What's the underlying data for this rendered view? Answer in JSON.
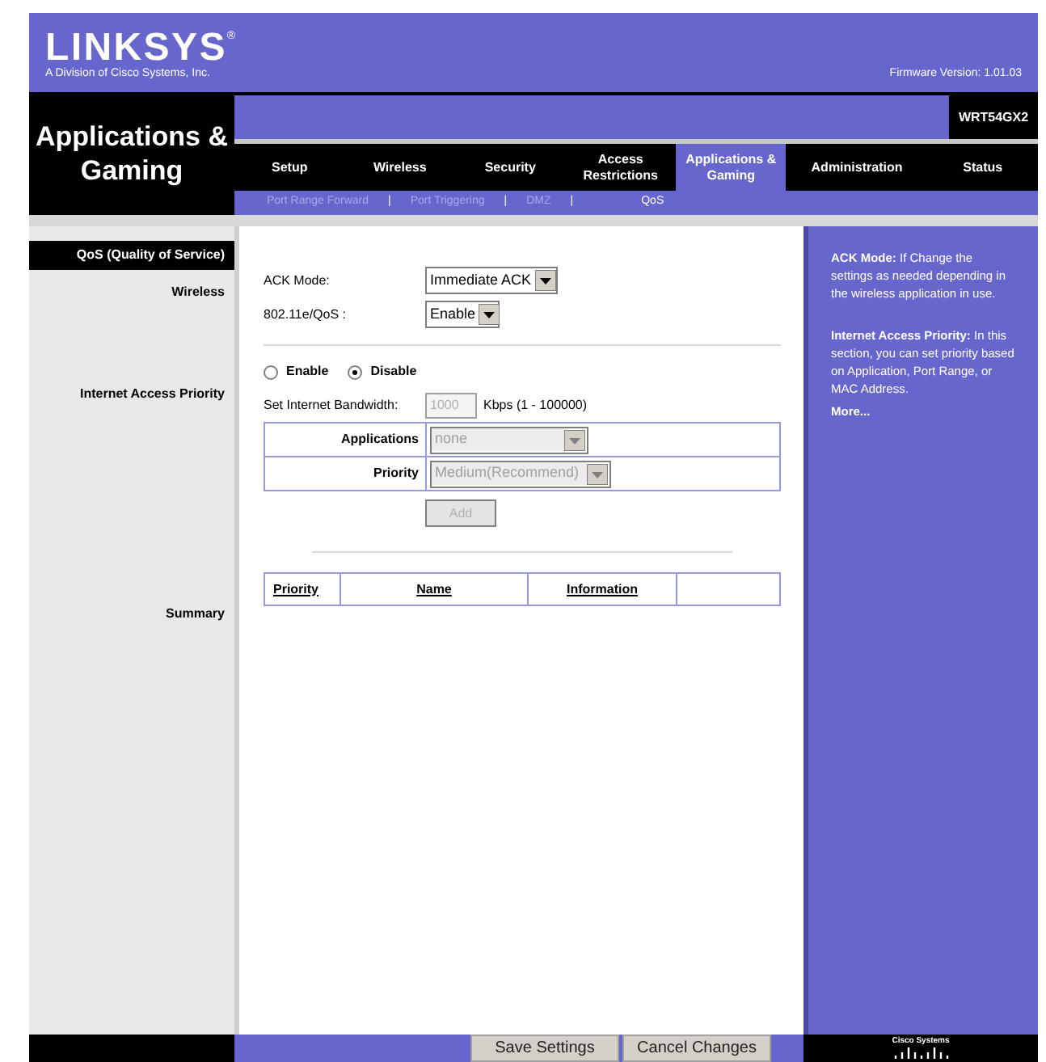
{
  "header": {
    "logo": "LINKSYS",
    "registered": "®",
    "tagline": "A Division of Cisco Systems, Inc.",
    "firmware": "Firmware Version: 1.01.03"
  },
  "section_title": "Applications & Gaming",
  "model": "WRT54GX2",
  "tabs": [
    {
      "label": "Setup",
      "selected": false
    },
    {
      "label": "Wireless",
      "selected": false
    },
    {
      "label": "Security",
      "selected": false
    },
    {
      "label": "Access Restrictions",
      "selected": false
    },
    {
      "label": "Applications & Gaming",
      "selected": true
    },
    {
      "label": "Administration",
      "selected": false
    },
    {
      "label": "Status",
      "selected": false
    }
  ],
  "subtabs": [
    {
      "label": "Port Range Forward",
      "selected": false
    },
    {
      "label": "Port Triggering",
      "selected": false
    },
    {
      "label": "DMZ",
      "selected": false
    },
    {
      "label": "QoS",
      "selected": true
    }
  ],
  "separator": "|",
  "page_heading": "QoS (Quality of Service)",
  "wireless": {
    "label": "Wireless",
    "ack_mode_label": "ACK Mode:",
    "ack_mode": "Immediate ACK",
    "qos_label": "802.11e/QoS :",
    "qos": "Enable"
  },
  "internet_access_priority": {
    "label": "Internet Access Priority",
    "options": [
      {
        "label": "Enable",
        "selected": false
      },
      {
        "label": "Disable",
        "selected": true
      }
    ],
    "bandwidth_label": "Set Internet Bandwidth:",
    "bandwidth": "1000",
    "bandwidth_unit": "Kbps (1 - 100000)",
    "applications_label": "Applications",
    "applications": "none",
    "priority_label": "Priority",
    "priority": "Medium(Recommend)",
    "add": "Add",
    "disabled": true
  },
  "summary": {
    "label": "Summary",
    "columns": [
      "Priority",
      "Name",
      "Information"
    ]
  },
  "help": [
    {
      "title": "ACK Mode:",
      "text": "If Change the settings as needed depending in the wireless application in use."
    },
    {
      "title": "Internet Access Priority:",
      "text": "In this section, you can set priority based on Application, Port Range, or MAC Address."
    }
  ],
  "more": "More...",
  "cisco": "Cisco Systems",
  "buttons": [
    "Save Settings",
    "Cancel Changes"
  ]
}
